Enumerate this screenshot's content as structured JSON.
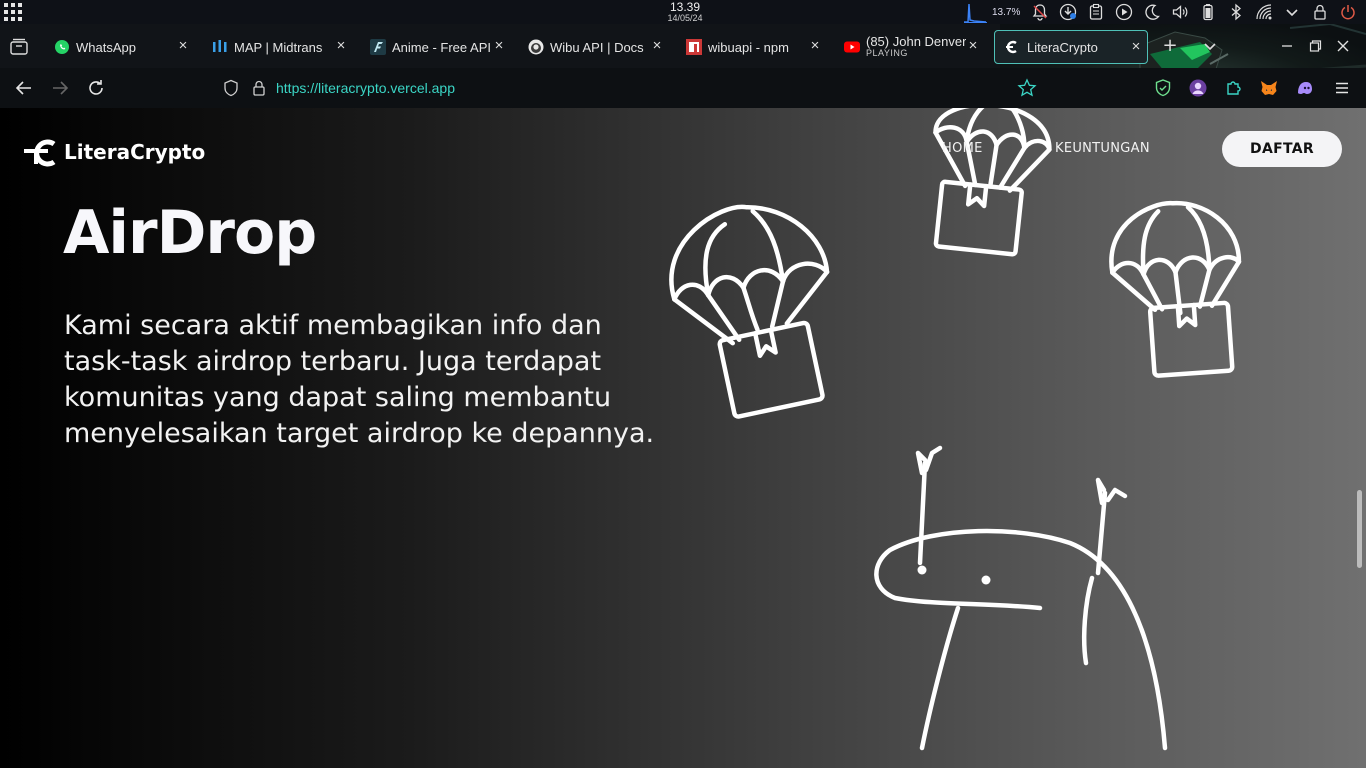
{
  "os": {
    "time": "13.39",
    "date": "14/05/24",
    "cpu_percent": "13.7%",
    "tray_icons": [
      "cpu-graph-icon",
      "notifications-off-icon",
      "updates-icon",
      "clipboard-icon",
      "media-play-icon",
      "night-light-icon",
      "volume-icon",
      "battery-icon",
      "bluetooth-icon",
      "wifi-icon",
      "chevron-down-icon",
      "lock-icon",
      "power-icon"
    ]
  },
  "browser": {
    "tabs": [
      {
        "label": "WhatsApp",
        "icon": "whatsapp-icon",
        "active": false
      },
      {
        "label": "MAP | Midtrans",
        "icon": "midtrans-icon",
        "active": false
      },
      {
        "label": "Anime - Free API",
        "icon": "anime-api-icon",
        "active": false
      },
      {
        "label": "Wibu API | Docs",
        "icon": "wibu-api-icon",
        "active": false
      },
      {
        "label": "wibuapi - npm",
        "icon": "npm-icon",
        "active": false
      },
      {
        "label": "(85) John Denver",
        "sublabel": "PLAYING",
        "icon": "youtube-icon",
        "active": false
      },
      {
        "label": "LiteraCrypto",
        "icon": "literacrypto-icon",
        "active": true
      }
    ],
    "close_glyph": "×",
    "new_tab_glyph": "+",
    "url": {
      "scheme": "https://",
      "host": "literacrypto.vercel.app"
    },
    "accent": "#4fc1b8"
  },
  "page": {
    "brand": "LiteraCrypto",
    "nav": {
      "home": "HOME",
      "benefits": "KEUNTUNGAN"
    },
    "cta": "DAFTAR",
    "hero_title": "AirDrop",
    "hero_text": "Kami secara aktif membagikan info dan task-task airdrop terbaru. Juga terdapat komunitas yang dapat saling membantu menyelesaikan target airdrop ke depannya."
  }
}
